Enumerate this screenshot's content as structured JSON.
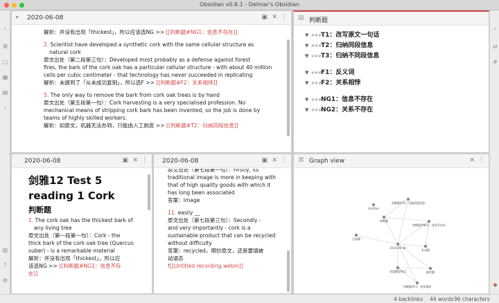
{
  "window": {
    "title": "Obsidian v0.8.1 - Delmar's Obsidian"
  },
  "colors": {
    "accent": "#d64545",
    "text": "#222222",
    "muted": "#888888"
  },
  "ribbon_icons": [
    "chevron-right-icon",
    "graph-icon",
    "file-icon",
    "calendar-icon",
    "archive-icon",
    "microphone-icon",
    "vault-icon",
    "help-icon",
    "settings-icon"
  ],
  "pane_top_left": {
    "title": "2020-06-08",
    "lines": [
      {
        "t": "解析：并没有出现「thickest」，所以应该选NG >> ",
        "link": "[[判断题#NG1：信息不存在]]"
      },
      {
        "gap": true
      },
      {
        "num": "2.",
        "t": "Scientist have developed a synthetic cork with the same cellular structure as"
      },
      {
        "t": "natural cork",
        "indent": true
      },
      {
        "t": "原文出处（第二段第三句）：Developed most probably as a defense against forest"
      },
      {
        "t": "fires, the bark of the cork oak has a particular cellular structure - with about 40 million"
      },
      {
        "t": "cells per cubic centimeter - that technology has never succeeded in replicating"
      },
      {
        "t": "解析：未提到了「从未成功复制」，所以选F >> ",
        "link": "[[判断题#F2：关系相悖]]"
      },
      {
        "gap": true
      },
      {
        "num": "5.",
        "t": "The only way to remove the bark from cork oak trees is by hand"
      },
      {
        "t": "原文出处（第五段第一句）：Cork harvesting is a very specialised profession. No"
      },
      {
        "t": "mechanical means of stripping cork bark has been invented, so the job is done by"
      },
      {
        "t": "teams of highly skilled workers."
      },
      {
        "t": "解析：如原文，机器无法办到，只能由人工剥皮 >> ",
        "link": "[[判断题#T2：归纳同段信息]]"
      }
    ]
  },
  "pane_outline": {
    "title": "判断题",
    "items": [
      {
        "label": "T1：改写原文一句话"
      },
      {
        "label": "T2：归纳同段信息"
      },
      {
        "label": "T3：归纳不同段信息"
      },
      {
        "gap": true
      },
      {
        "label": "F1：反义词"
      },
      {
        "label": "F2：关系相悖"
      },
      {
        "gap": true
      },
      {
        "label": "NG1：信息不存在"
      },
      {
        "label": "NG2：关系不存在"
      }
    ]
  },
  "pane_bottom_left": {
    "title": "2020-06-08",
    "heading1_line1": "剑雅12 Test 5",
    "heading1_line2": "reading 1 Cork",
    "heading2": "判断题",
    "lines": [
      {
        "num": "1.",
        "t": "The cork oak has the thickest bark of"
      },
      {
        "t": "any living tree",
        "indent": true
      },
      {
        "t": "原文出处（第一段第一句）：Cork - the"
      },
      {
        "t": "thick bark of the cork oak tree (Quercus"
      },
      {
        "t": "suber) - is a remarkable material"
      },
      {
        "t": "解析：并没有出现「thickest」，所以应"
      },
      {
        "t": "该选NG >> ",
        "link": "[[判断题#NG1：信息不存"
      },
      {
        "t": "",
        "link": "在]]"
      }
    ]
  },
  "pane_bottom_mid": {
    "title": "2020-06-08",
    "lines": [
      {
        "t": "原文出处（第七段第一句）：Firstly, its"
      },
      {
        "t": "traditional image is more in keeping with"
      },
      {
        "t": "that of high quality goods with which it"
      },
      {
        "t": "has long been associated"
      },
      {
        "t": "答案：image"
      },
      {
        "gap": true
      },
      {
        "num": "11.",
        "t": "easily __"
      },
      {
        "t": "原文出处（第七段第三句）：Secondly -"
      },
      {
        "t": "and very importantly - cork is a"
      },
      {
        "t": "sustainable product that can be recycled"
      },
      {
        "t": "without difficulty"
      },
      {
        "t": "答案：recycled，照抄原文，还是要填被"
      },
      {
        "t": "动语态"
      },
      {
        "t": "!",
        "link": "[[Untitled recording.webm]]"
      }
    ]
  },
  "pane_graph": {
    "title": "Graph view",
    "nodes": [
      {
        "label": "Untitled"
      },
      {
        "label": "判断题"
      },
      {
        "label": "判断题#T2：归纳同段信息"
      },
      {
        "label": "判断题#NG1：信息不存在"
      },
      {
        "label": "2020-06-08"
      },
      {
        "label": "已标题"
      },
      {
        "label": "文化题"
      },
      {
        "label": "填空题"
      },
      {
        "label": "词语题型特点"
      },
      {
        "label": "判断题#F2：关系相悖"
      }
    ]
  },
  "status": {
    "backlinks": "4 backlinks",
    "words": "44 words",
    "characters": "96 characters"
  }
}
